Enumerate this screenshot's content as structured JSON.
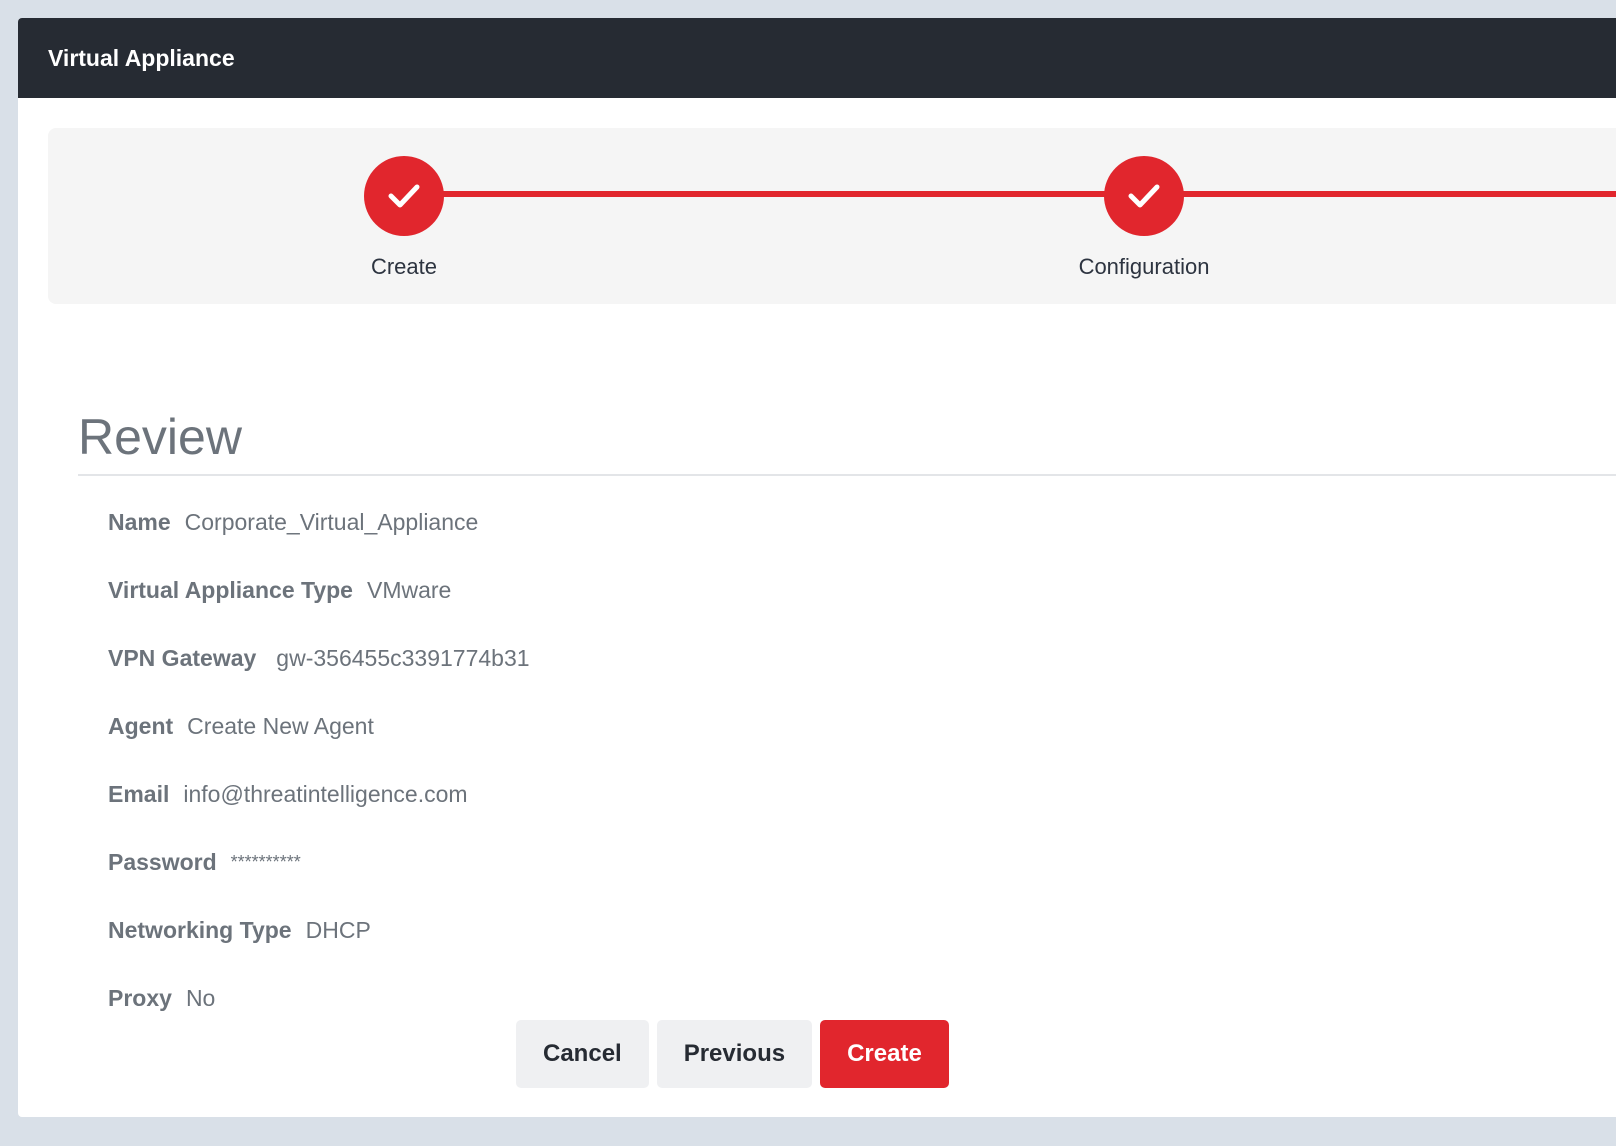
{
  "header": {
    "title": "Virtual Appliance"
  },
  "stepper": {
    "steps": [
      {
        "label": "Create",
        "status": "complete"
      },
      {
        "label": "Configuration",
        "status": "complete"
      }
    ]
  },
  "review": {
    "title": "Review",
    "fields": [
      {
        "label": "Name",
        "value": "Corporate_Virtual_Appliance"
      },
      {
        "label": "Virtual Appliance Type",
        "value": "VMware"
      },
      {
        "label": "VPN Gateway",
        "value": "gw-356455c3391774b31"
      },
      {
        "label": "Agent",
        "value": "Create New Agent"
      },
      {
        "label": "Email",
        "value": "info@threatintelligence.com"
      },
      {
        "label": "Password",
        "value": "**********"
      },
      {
        "label": "Networking Type",
        "value": "DHCP"
      },
      {
        "label": "Proxy",
        "value": "No"
      }
    ]
  },
  "actions": {
    "cancel_label": "Cancel",
    "previous_label": "Previous",
    "create_label": "Create"
  },
  "colors": {
    "accent": "#e1262d",
    "header_bg": "#262b33",
    "page_bg": "#d9e0e8"
  }
}
